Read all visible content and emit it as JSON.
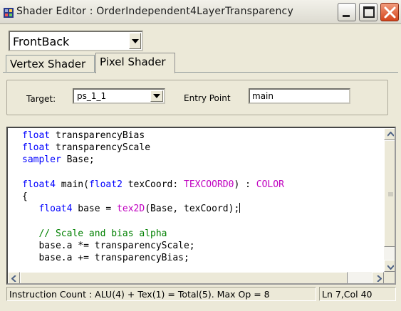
{
  "window": {
    "title": "Shader Editor : OrderIndependent4LayerTransparency",
    "icon": "shader-app-icon"
  },
  "mode_select": {
    "value": "FrontBack"
  },
  "tabs": [
    {
      "label": "Vertex Shader",
      "active": false
    },
    {
      "label": "Pixel Shader",
      "active": true
    }
  ],
  "settings": {
    "target_label": "Target:",
    "target_value": "ps_1_1",
    "entry_label": "Entry Point",
    "entry_value": "main"
  },
  "code": {
    "lines": [
      [
        {
          "t": "float",
          "c": "kw"
        },
        {
          "t": " transparencyBias",
          "c": ""
        }
      ],
      [
        {
          "t": "float",
          "c": "kw"
        },
        {
          "t": " transparencyScale",
          "c": ""
        }
      ],
      [
        {
          "t": "sampler",
          "c": "kw"
        },
        {
          "t": " Base;",
          "c": ""
        }
      ],
      [],
      [
        {
          "t": "float4",
          "c": "kw"
        },
        {
          "t": " main(",
          "c": ""
        },
        {
          "t": "float2",
          "c": "kw"
        },
        {
          "t": " texCoord: ",
          "c": ""
        },
        {
          "t": "TEXCOORD0",
          "c": "sem"
        },
        {
          "t": ") : ",
          "c": ""
        },
        {
          "t": "COLOR",
          "c": "sem"
        }
      ],
      [
        {
          "t": "{",
          "c": ""
        }
      ],
      [
        {
          "t": "   ",
          "c": ""
        },
        {
          "t": "float4",
          "c": "kw"
        },
        {
          "t": " base = ",
          "c": ""
        },
        {
          "t": "tex2D",
          "c": "fn"
        },
        {
          "t": "(Base, texCoord);",
          "c": ""
        },
        {
          "t": "",
          "c": "caret"
        }
      ],
      [],
      [
        {
          "t": "   ",
          "c": ""
        },
        {
          "t": "// Scale and bias alpha",
          "c": "cm"
        }
      ],
      [
        {
          "t": "   base.a *= transparencyScale;",
          "c": ""
        }
      ],
      [
        {
          "t": "   base.a += transparencyBias;",
          "c": ""
        }
      ]
    ]
  },
  "status": {
    "main": "Instruction Count :  ALU(4) + Tex(1) = Total(5).  Max Op = 8",
    "position": "Ln 7,Col 40"
  },
  "colors": {
    "keyword": "#0000ff",
    "semantic": "#c000c0",
    "comment": "#008000"
  }
}
